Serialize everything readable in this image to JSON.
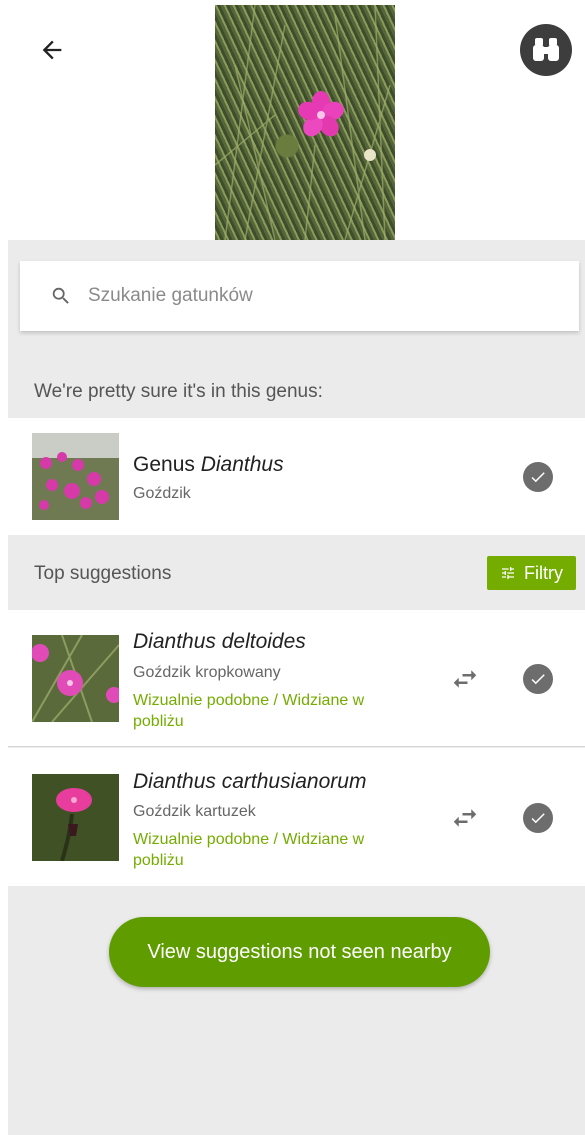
{
  "search": {
    "placeholder": "Szukanie gatunków"
  },
  "genus_section": {
    "heading": "We're pretty sure it's in this genus:",
    "rank": "Genus",
    "taxon": "Dianthus",
    "common_name": "Goździk"
  },
  "suggestions_section": {
    "heading": "Top suggestions",
    "filter_label": "Filtry"
  },
  "suggestions": [
    {
      "scientific_name": "Dianthus deltoides",
      "common_name": "Goździk kropkowany",
      "reason": "Wizualnie podobne / Widziane w pobliżu"
    },
    {
      "scientific_name": "Dianthus carthusianorum",
      "common_name": "Goździk kartuzek",
      "reason": "Wizualnie podobne / Widziane w pobliżu"
    }
  ],
  "footer": {
    "view_not_nearby_label": "View suggestions not seen nearby"
  },
  "colors": {
    "accent_green": "#74ac00",
    "button_green": "#5f9c00",
    "icon_grey": "#6d6d6d"
  },
  "icons": [
    "arrow-back-icon",
    "binoculars-icon",
    "search-icon",
    "check-icon",
    "compare-icon",
    "filter-icon"
  ]
}
